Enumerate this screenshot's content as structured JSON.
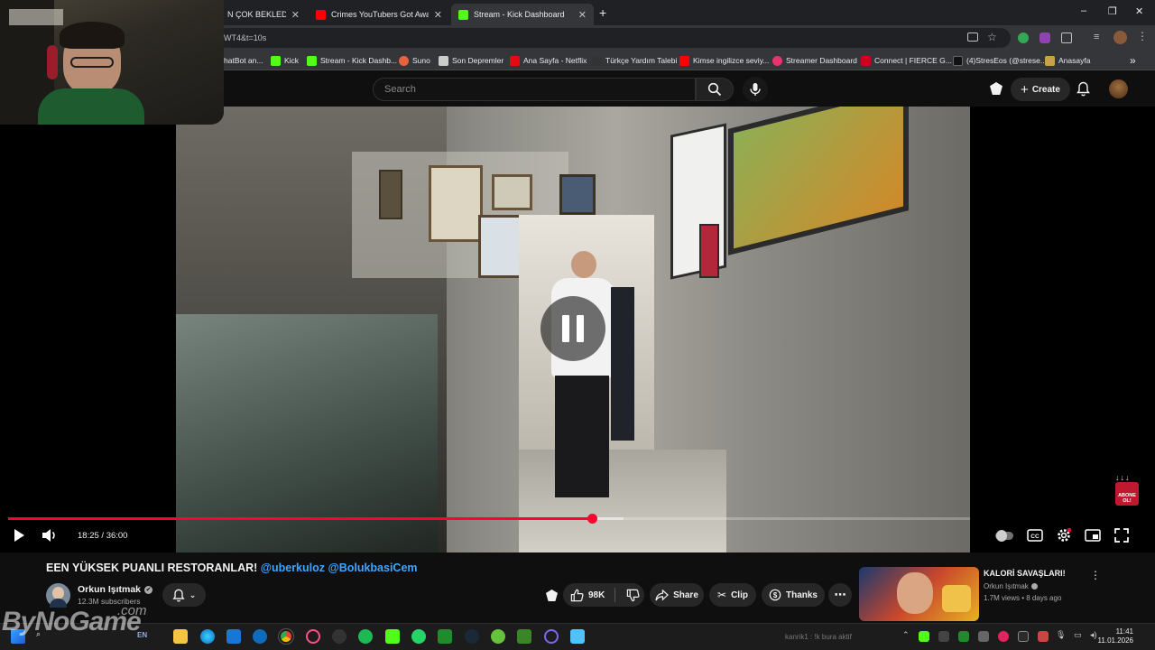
{
  "browser": {
    "tabs": [
      {
        "label": "N ÇOK BEKLEDİĞİM",
        "favicon_color": "#ff0000"
      },
      {
        "label": "Crimes YouTubers Got Away W",
        "favicon_color": "#ff0000"
      },
      {
        "label": "Stream - Kick Dashboard",
        "favicon_color": "#53fc18"
      }
    ],
    "new_tab": "+",
    "url": "WT4&t=10s",
    "window_controls": [
      "–",
      "❐",
      "✕"
    ],
    "bookmarks": [
      {
        "label": "hatBot an...",
        "color": "#888888"
      },
      {
        "label": "Kick",
        "color": "#53fc18"
      },
      {
        "label": "Stream - Kick Dashb...",
        "color": "#53fc18"
      },
      {
        "label": "Suno",
        "color": "#e8623b"
      },
      {
        "label": "Son Depremler",
        "color": "#cccccc"
      },
      {
        "label": "Ana Sayfa - Netflix",
        "color": "#e50914"
      },
      {
        "label": "Türkçe Yardım Talebi",
        "color": "#333333"
      },
      {
        "label": "Kimse ingilizce seviy...",
        "color": "#ff0000"
      },
      {
        "label": "Streamer Dashboard",
        "color": "#e8336d"
      },
      {
        "label": "Connect | FIERCE G...",
        "color": "#d0021b"
      },
      {
        "label": "(4)StresEos (@strese...",
        "color": "#111111"
      },
      {
        "label": "Anasayfa",
        "color": "#c8a24a"
      }
    ],
    "more_bookmarks": "»"
  },
  "youtube": {
    "search_placeholder": "Search",
    "create_label": "Create",
    "video": {
      "current_time": "18:25",
      "duration": "36:00",
      "time_display": "18:25 / 36:00",
      "progress": 0.6074,
      "buffered": 0.64,
      "subscribe_badge": "ABONE OL!"
    },
    "title_prefix": "EEN YÜKSEK PUANLI RESTORANLAR!",
    "mention_1": "@uberkuloz",
    "mention_2": "@BolukbasiCem",
    "channel": {
      "name": "Orkun Işıtmak",
      "verified": "✔",
      "subscribers": "12.3M subscribers"
    },
    "actions": {
      "likes": "98K",
      "share": "Share",
      "clip": "Clip",
      "thanks": "Thanks",
      "more": "⋯"
    },
    "related": {
      "title": "KALORİ SAVAŞLARI!",
      "channel": "Orkun Işıtmak",
      "meta": "1.7M views • 8 days ago"
    }
  },
  "taskbar": {
    "time": "11:41",
    "date": "11.01.2026",
    "search_hint": "kanrik1 : !k bura aktif",
    "taskbar_label": "EN"
  },
  "watermark": {
    "text": "ByNoGame",
    "suffix": ".com"
  }
}
